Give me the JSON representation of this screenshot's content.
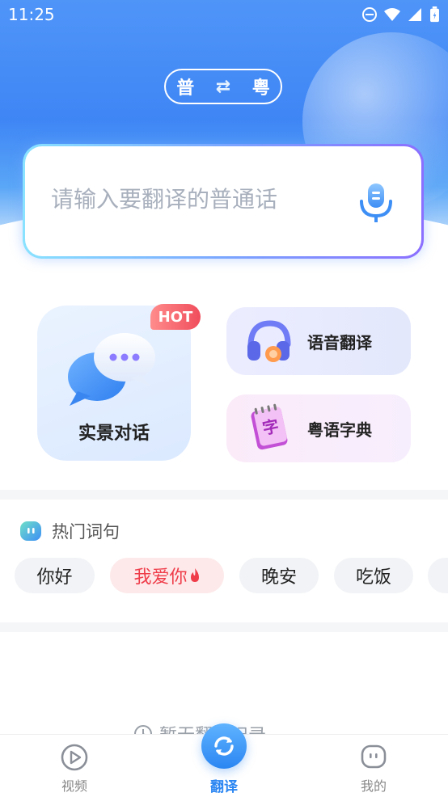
{
  "status_bar": {
    "time": "11:25"
  },
  "lang_switch": {
    "from": "普",
    "to": "粤"
  },
  "input": {
    "placeholder": "请输入要翻译的普通话"
  },
  "features": {
    "scene_chat": {
      "label": "实景对话",
      "badge": "HOT"
    },
    "voice_translate": {
      "label": "语音翻译"
    },
    "dictionary": {
      "label": "粤语字典",
      "glyph": "字"
    }
  },
  "hot_phrases": {
    "title": "热门词句",
    "items": [
      "你好",
      "我爱你",
      "晚安",
      "吃饭"
    ]
  },
  "history": {
    "label": "暂无翻译记录"
  },
  "nav": {
    "video": "视频",
    "translate": "翻译",
    "mine": "我的"
  },
  "colors": {
    "accent": "#2b86f2",
    "hot": "#f04d5b"
  }
}
